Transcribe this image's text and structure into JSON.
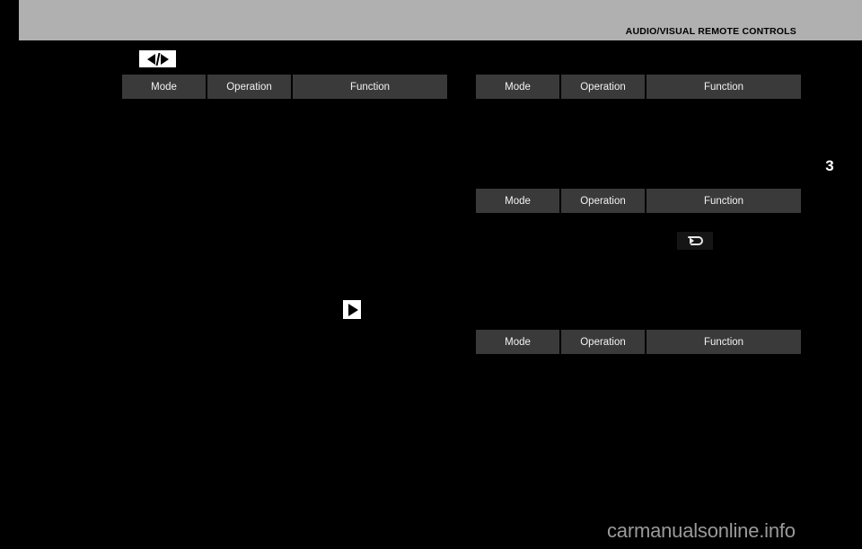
{
  "document": {
    "header_title": "AUDIO/VISUAL REMOTE CONTROLS",
    "page_marker": "3",
    "watermark": "carmanualsonline.info",
    "background_color": "#000000",
    "header_band_color": "#b0b0b0",
    "table_header_color": "#3a3a3a",
    "table_text_color": "#f2f2f2"
  },
  "tables": [
    {
      "id": "left-table-1",
      "columns": [
        "Mode",
        "Operation",
        "Function"
      ]
    },
    {
      "id": "right-table-1",
      "columns": [
        "Mode",
        "Operation",
        "Function"
      ]
    },
    {
      "id": "right-table-2",
      "columns": [
        "Mode",
        "Operation",
        "Function"
      ]
    },
    {
      "id": "right-table-3",
      "columns": [
        "Mode",
        "Operation",
        "Function"
      ]
    }
  ],
  "icons": [
    {
      "id": "prev-next",
      "name": "prev-next-track-icon"
    },
    {
      "id": "play",
      "name": "play-icon"
    },
    {
      "id": "return",
      "name": "return-back-icon"
    }
  ]
}
